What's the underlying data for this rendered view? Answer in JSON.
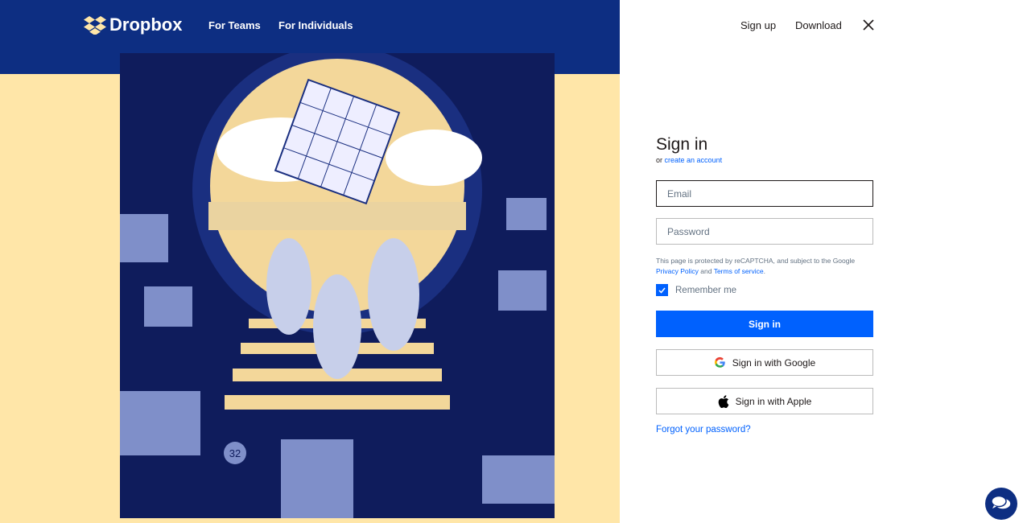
{
  "header": {
    "brand": "Dropbox",
    "nav": [
      "For Teams",
      "For Individuals"
    ],
    "right": [
      "Sign up",
      "Download"
    ],
    "close_icon": "close-icon"
  },
  "colors": {
    "navy": "#0d2e82",
    "cream": "#ffe6a8",
    "accent": "#0061fe"
  },
  "illustration": {
    "counter_badge": "32"
  },
  "form": {
    "title": "Sign in",
    "sub_prefix": "or",
    "create_link": "create an account",
    "email_placeholder": "Email",
    "password_placeholder": "Password",
    "legal_pre": "This page is protected by reCAPTCHA, and subject to the Google",
    "privacy": "Privacy Policy",
    "and": "and",
    "terms": "Terms of service",
    "period": ".",
    "remember": "Remember me",
    "remember_checked": true,
    "signin": "Sign in",
    "google": "Sign in with Google",
    "apple": "Sign in with Apple",
    "forgot": "Forgot your password?"
  },
  "chat": {
    "icon": "chat-bubbles-icon"
  }
}
